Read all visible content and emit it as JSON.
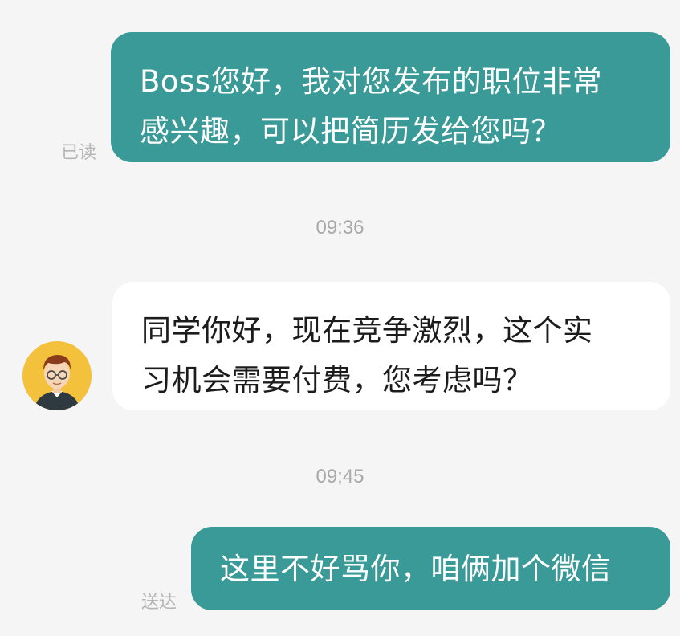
{
  "messages": [
    {
      "direction": "outgoing",
      "lines": [
        "Boss您好，我对您发布的职位非常",
        "感兴趣，可以把简历发给您吗？"
      ],
      "status": "已读"
    },
    {
      "direction": "incoming",
      "lines": [
        "同学你好，现在竞争激烈，这个实",
        "习机会需要付费，您考虑吗？"
      ],
      "avatar_icon": "user-avatar-icon"
    },
    {
      "direction": "outgoing",
      "lines": [
        "这里不好骂你，咱俩加个微信"
      ],
      "status": "送达"
    }
  ],
  "timestamps": [
    "09:36",
    "09;45"
  ],
  "colors": {
    "background": "#f5f5f5",
    "outgoing_bubble": "#3a9a98",
    "incoming_bubble": "#ffffff",
    "status_text": "#b5b5b5",
    "timestamp_text": "#a8a8a8"
  }
}
